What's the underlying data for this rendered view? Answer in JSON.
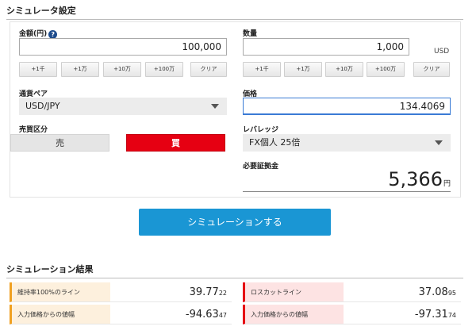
{
  "settings_title": "シミュレータ設定",
  "amount": {
    "label": "金額(円)",
    "value": "100,000",
    "buttons": [
      "+1千",
      "+1万",
      "+10万",
      "+100万",
      "クリア"
    ]
  },
  "quantity": {
    "label": "数量",
    "value": "1,000",
    "unit": "USD",
    "buttons": [
      "+1千",
      "+1万",
      "+10万",
      "+100万",
      "クリア"
    ]
  },
  "pair": {
    "label": "通貨ペア",
    "selected": "USD/JPY"
  },
  "price": {
    "label": "価格",
    "value": "134.4069"
  },
  "trade": {
    "label": "売買区分",
    "sell": "売",
    "buy": "買"
  },
  "leverage": {
    "label": "レバレッジ",
    "selected": "FX個人 25倍"
  },
  "margin": {
    "label": "必要証拠金",
    "value": "5,366",
    "currency": "円"
  },
  "simulate_label": "シミュレーションする",
  "results_title": "シミュレーション結果",
  "results": {
    "maintenance_line": {
      "label": "維持率100%のライン",
      "int": "39.77",
      "frac": "22"
    },
    "maintenance_width": {
      "label": "入力価格からの値幅",
      "int": "-94.63",
      "frac": "47"
    },
    "losscut_line": {
      "label": "ロスカットライン",
      "int": "37.08",
      "frac": "95"
    },
    "losscut_width": {
      "label": "入力価格からの値幅",
      "int": "-97.31",
      "frac": "74"
    }
  },
  "colors": {
    "buy": "#e60012",
    "simulate": "#1a96d4",
    "accent_orange": "#f0a020",
    "accent_red": "#e60012"
  }
}
